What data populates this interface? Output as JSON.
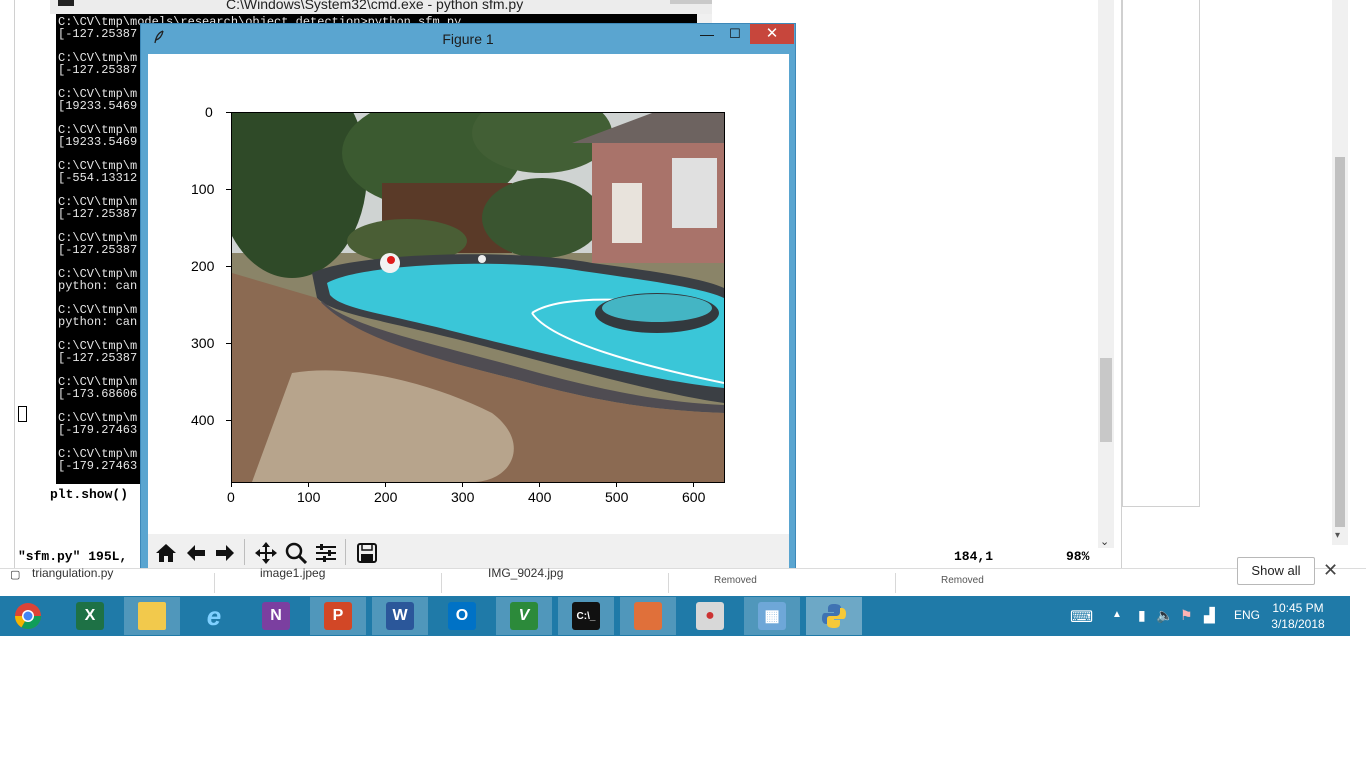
{
  "vim": {
    "status_left": "\"sfm.py\" 195L, ",
    "status_pos": "184,1",
    "status_pct": "98%",
    "code_line": "plt.show()"
  },
  "cmd": {
    "title": "C:\\Windows\\System32\\cmd.exe - python  sfm.py",
    "lines": [
      "C:\\CV\\tmp\\models\\research\\object_detection>python sfm.py",
      "[-127.25387",
      "",
      "C:\\CV\\tmp\\m",
      "[-127.25387",
      "",
      "C:\\CV\\tmp\\m",
      "[19233.5469",
      "",
      "C:\\CV\\tmp\\m",
      "[19233.5469",
      "",
      "C:\\CV\\tmp\\m",
      "[-554.13312",
      "",
      "C:\\CV\\tmp\\m",
      "[-127.25387",
      "",
      "C:\\CV\\tmp\\m",
      "[-127.25387",
      "",
      "C:\\CV\\tmp\\m",
      "python: can",
      "",
      "C:\\CV\\tmp\\m",
      "python: can",
      "",
      "C:\\CV\\tmp\\m",
      "[-127.25387",
      "",
      "C:\\CV\\tmp\\m",
      "[-173.68606",
      "",
      "C:\\CV\\tmp\\m",
      "[-179.27463",
      "",
      "C:\\CV\\tmp\\m",
      "[-179.27463"
    ]
  },
  "figure": {
    "title": "Figure 1",
    "minimize": "—",
    "maximize": "☐",
    "close": "✕",
    "y_ticks": [
      "0",
      "100",
      "200",
      "300",
      "400"
    ],
    "x_ticks": [
      "0",
      "100",
      "200",
      "300",
      "400",
      "500",
      "600"
    ],
    "toolbar": [
      "home-icon",
      "back-icon",
      "forward-icon",
      "pan-icon",
      "zoom-icon",
      "configure-icon",
      "save-icon"
    ]
  },
  "downloads": {
    "items": [
      {
        "name": "triangulation.py",
        "status": ""
      },
      {
        "name": "image1.jpeg",
        "status": ""
      },
      {
        "name": "IMG_9024.jpg",
        "status": ""
      },
      {
        "name": "",
        "status": "Removed"
      },
      {
        "name": "",
        "status": "Removed"
      }
    ],
    "show_all": "Show all",
    "close": "✕"
  },
  "taskbar": {
    "apps": [
      "chrome",
      "excel",
      "file-explorer",
      "internet-explorer",
      "onenote",
      "powerpoint",
      "word",
      "outlook",
      "vim",
      "cmd",
      "snipping",
      "paint",
      "calculator",
      "python"
    ],
    "active": "python",
    "lang": "ENG",
    "time": "10:45 PM",
    "date": "3/18/2018"
  }
}
